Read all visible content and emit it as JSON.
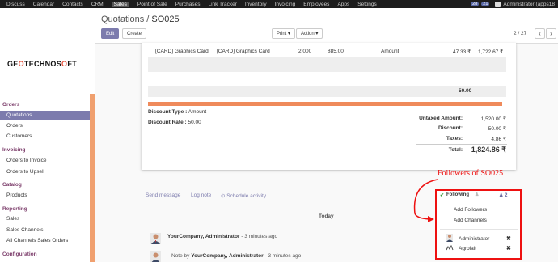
{
  "topbar": {
    "menu": [
      "Discuss",
      "Calendar",
      "Contacts",
      "CRM",
      "Sales",
      "Point of Sale",
      "Purchases",
      "Link Tracker",
      "Inventory",
      "Invoicing",
      "Employees",
      "Apps",
      "Settings"
    ],
    "active_menu": "Sales",
    "badge1": "28",
    "badge2": "21",
    "user": "Administrator (apps18"
  },
  "sidebar": {
    "logo": "GEOTECHNOSOFT",
    "sections": {
      "orders": "Orders",
      "invoicing": "Invoicing",
      "catalog": "Catalog",
      "reporting": "Reporting",
      "configuration": "Configuration"
    },
    "items": {
      "quotations": "Quotations",
      "orders": "Orders",
      "customers": "Customers",
      "orders_to_invoice": "Orders to Invoice",
      "orders_to_upsell": "Orders to Upsell",
      "products": "Products",
      "sales": "Sales",
      "sales_channels": "Sales Channels",
      "all_channels_sales_orders": "All Channels Sales Orders"
    }
  },
  "control": {
    "breadcrumb": "Quotations /",
    "record": "SO025",
    "edit": "Edit",
    "create": "Create",
    "print": "Print ▾",
    "action": "Action ▾",
    "pager": "2 / 27",
    "prev": "‹",
    "next": "›"
  },
  "sheet": {
    "line": {
      "product": "[CARD] Graphics Card",
      "description": "[CARD] Graphics Card",
      "qty": "2.000",
      "price": "885.00",
      "type": "Amount",
      "taxes": "47.33 ₹",
      "subtotal": "1,722.67 ₹"
    },
    "section_amount": "50.00",
    "discount_type_label": "Discount Type :",
    "discount_type_value": "Amount",
    "discount_rate_label": "Discount Rate :",
    "discount_rate_value": "50.00",
    "totals": {
      "untaxed_label": "Untaxed Amount:",
      "untaxed_value": "1,520.00 ₹",
      "discount_label": "Discount:",
      "discount_value": "50.00 ₹",
      "taxes_label": "Taxes:",
      "taxes_value": "4.86 ₹",
      "total_label": "Total:",
      "total_value": "1,824.86 ₹"
    }
  },
  "chatter": {
    "send_message": "Send message",
    "log_note": "Log note",
    "schedule_activity": "Schedule activity",
    "today": "Today",
    "msg1_author": "YourCompany, Administrator",
    "msg1_time": "- 3 minutes ago",
    "msg2_prefix": "Note by",
    "msg2_author": "YourCompany, Administrator",
    "msg2_time": "- 3 minutes ago"
  },
  "followers": {
    "annotation": "Followers of SO025",
    "following": "Following",
    "count": "2",
    "add_followers": "Add Followers",
    "add_channels": "Add Channels",
    "list": [
      "Administrator",
      "Agrolait"
    ]
  },
  "colors": {
    "accent": "#7c7bad",
    "orange": "#ef8a5b",
    "annotation_red": "#e11111"
  }
}
